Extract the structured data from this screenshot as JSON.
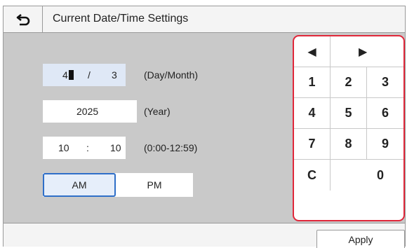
{
  "header": {
    "title": "Current Date/Time Settings",
    "back_icon": "back-arrow-icon"
  },
  "form": {
    "day_value": "4",
    "date_separator": "/",
    "month_value": "3",
    "day_month_label": "(Day/Month)",
    "year_value": "2025",
    "year_label": "(Year)",
    "hour_value": "10",
    "time_separator": ":",
    "minute_value": "10",
    "time_label": "(0:00-12:59)",
    "am_label": "AM",
    "pm_label": "PM",
    "selected_period": "AM"
  },
  "keypad": {
    "left_arrow": "◀",
    "right_arrow": "▶",
    "keys": [
      "1",
      "2",
      "3",
      "4",
      "5",
      "6",
      "7",
      "8",
      "9"
    ],
    "clear": "C",
    "zero": "0"
  },
  "footer": {
    "apply_label": "Apply"
  },
  "colors": {
    "keypad_border": "#e0273a",
    "selection_border": "#2f6fc8",
    "active_field": "#dfe8f6"
  }
}
